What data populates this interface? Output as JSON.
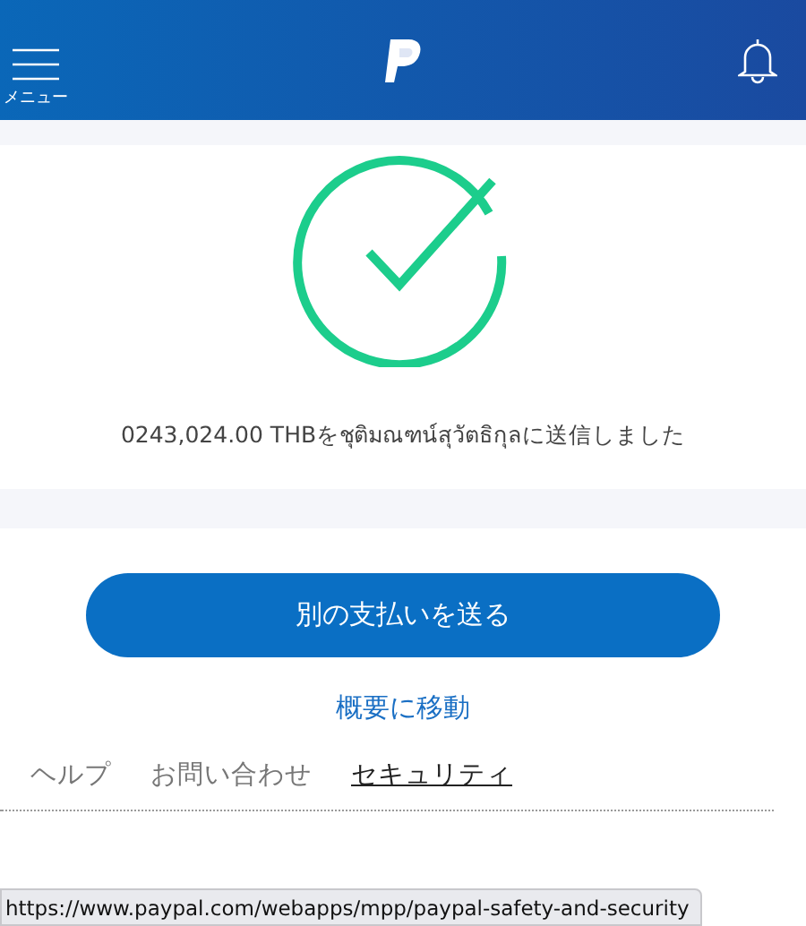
{
  "header": {
    "menu_label": "メニュー"
  },
  "confirmation": {
    "message": "0243,024.00 THBをชุติมณฑน์สุวัตธิกุลに送信しました"
  },
  "primary_button": "別の支払いを送る",
  "secondary_link": "概要に移動",
  "footer_links": [
    {
      "label": "ヘルプ",
      "hovered": false
    },
    {
      "label": "お問い合わせ",
      "hovered": false
    },
    {
      "label": "セキュリティ",
      "hovered": true
    }
  ],
  "status_bar": {
    "url": "https://www.paypal.com/webapps/mpp/paypal-safety-and-security"
  }
}
